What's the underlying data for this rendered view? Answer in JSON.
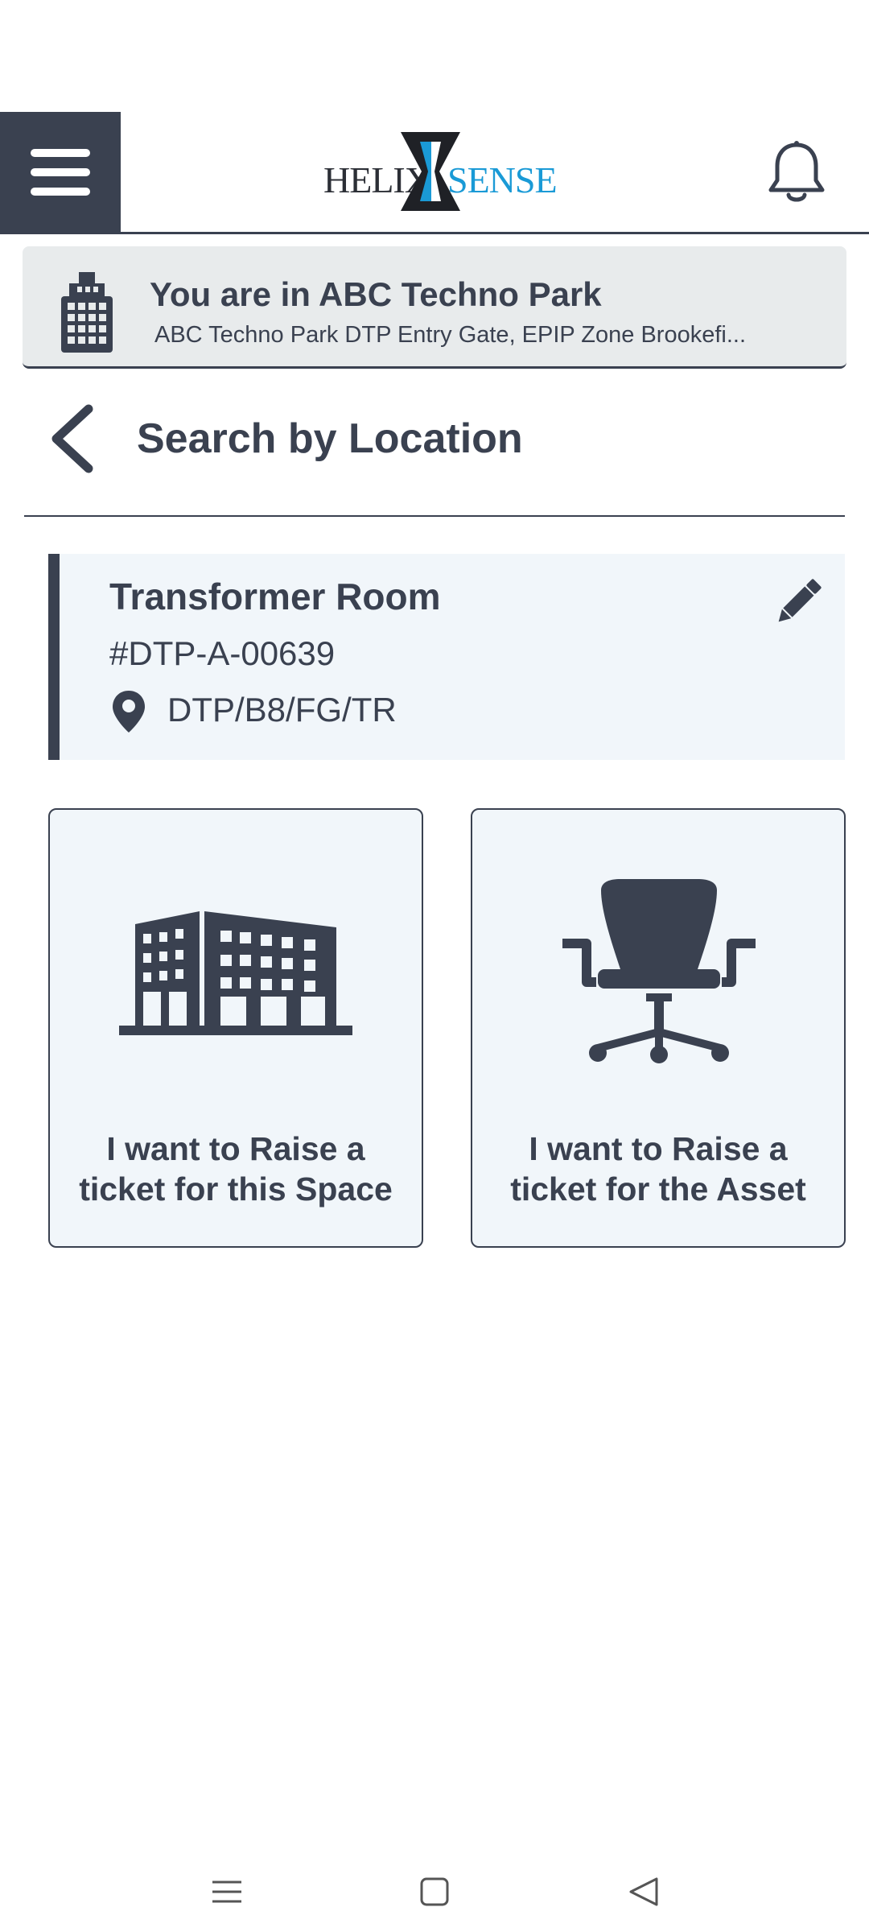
{
  "header": {
    "menu_icon": "hamburger-menu-icon",
    "logo_left": "HELIX",
    "logo_right": "SENSE",
    "notification_icon": "bell-icon",
    "colors": {
      "primary": "#3a4150",
      "brand_blue": "#1a9ad6"
    }
  },
  "location_banner": {
    "icon": "building-icon",
    "title": "You are in ABC Techno Park",
    "subtitle": "ABC Techno Park DTP Entry Gate, EPIP Zone Brookefi..."
  },
  "page": {
    "back_icon": "chevron-left-icon",
    "title": "Search by Location"
  },
  "location_card": {
    "name": "Transformer Room",
    "code": "#DTP-A-00639",
    "path_icon": "map-pin-icon",
    "path": "DTP/B8/FG/TR",
    "edit_icon": "pencil-icon"
  },
  "options": {
    "space": {
      "icon": "office-building-icon",
      "label": "I want to Raise a ticket for this Space"
    },
    "asset": {
      "icon": "office-chair-icon",
      "label": "I want to Raise a ticket for the Asset"
    }
  },
  "system_nav": {
    "recents_icon": "recents-icon",
    "home_icon": "home-icon",
    "back_icon": "back-triangle-icon"
  }
}
